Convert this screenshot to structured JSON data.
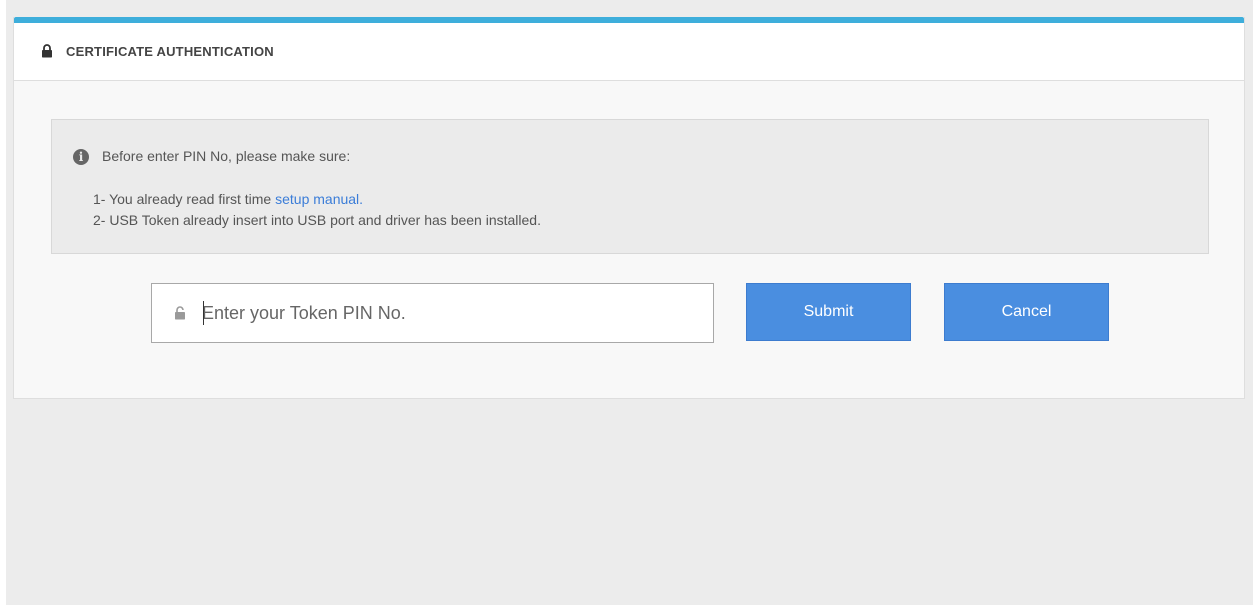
{
  "header": {
    "icon": "lock-icon",
    "title": "CERTIFICATE AUTHENTICATION"
  },
  "notice": {
    "icon": "info-icon",
    "icon_glyph": "i",
    "lead": "Before enter PIN No, please make sure:",
    "item1_prefix": "1- You already read first time ",
    "item1_link": "setup manual.",
    "item2": "2- USB Token already insert into USB port and driver has been installed."
  },
  "pin": {
    "icon": "unlock-icon",
    "placeholder": "Enter your Token PIN No.",
    "value": ""
  },
  "buttons": {
    "submit": "Submit",
    "cancel": "Cancel"
  },
  "colors": {
    "accent_bar": "#3eaedb",
    "button": "#4a8ee0",
    "link": "#3b7dd8"
  }
}
